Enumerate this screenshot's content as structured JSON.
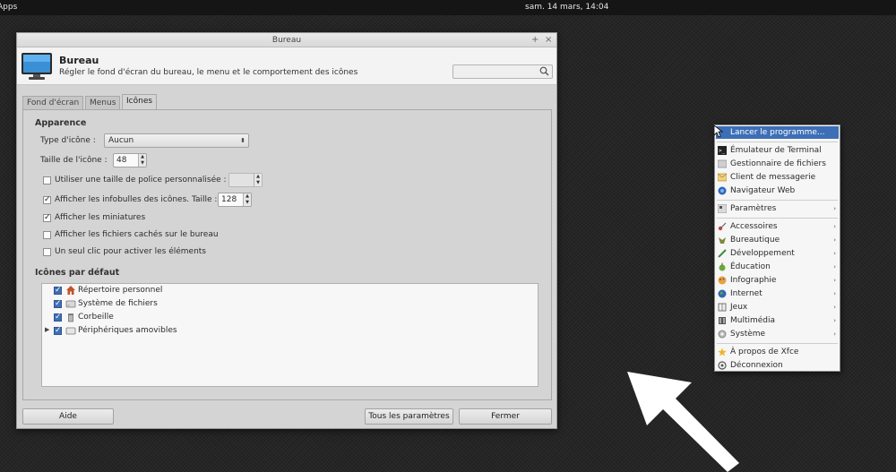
{
  "top_panel": {
    "apps_label": "Apps",
    "clock": "sam. 14 mars, 14:04"
  },
  "window": {
    "title": "Bureau",
    "controls": {
      "add": "+",
      "close": "×"
    },
    "header_title": "Bureau",
    "header_subtitle": "Régler le fond d'écran du bureau, le menu et le comportement des icônes",
    "search": {
      "value": "",
      "placeholder": ""
    },
    "tabs": [
      "Fond d'écran",
      "Menus",
      "Icônes"
    ],
    "active_tab": "Icônes",
    "appearance": {
      "section_title": "Apparence",
      "icon_type_label": "Type d'icône :",
      "icon_type_value": "Aucun",
      "icon_size_label": "Taille de l'icône :",
      "icon_size_value": "48",
      "custom_font_label": "Utiliser une taille de police personnalisée :",
      "custom_font_checked": false,
      "custom_font_value": "",
      "tooltips_label": "Afficher les infobulles des icônes. Taille :",
      "tooltips_checked": true,
      "tooltips_size_value": "128",
      "thumbnails_label": "Afficher les miniatures",
      "thumbnails_checked": true,
      "hidden_files_label": "Afficher les fichiers cachés sur le bureau",
      "hidden_files_checked": false,
      "single_click_label": "Un seul clic pour activer les éléments",
      "single_click_checked": false
    },
    "default_icons": {
      "section_title": "Icônes par défaut",
      "items": [
        {
          "label": "Répertoire personnel",
          "checked": true,
          "icon": "home-icon"
        },
        {
          "label": "Système de fichiers",
          "checked": true,
          "icon": "drive-icon"
        },
        {
          "label": "Corbeille",
          "checked": true,
          "icon": "trash-icon"
        },
        {
          "label": "Périphériques amovibles",
          "checked": true,
          "icon": "removable-drive-icon",
          "expandable": true
        }
      ]
    },
    "buttons": {
      "help": "Aide",
      "all_settings": "Tous les paramètres",
      "close": "Fermer"
    }
  },
  "menu": {
    "items": [
      {
        "label": "Lancer le programme...",
        "icon": "run-icon",
        "highlight": true
      },
      {
        "label": "Émulateur de Terminal",
        "icon": "terminal-icon"
      },
      {
        "label": "Gestionnaire de fichiers",
        "icon": "file-manager-icon"
      },
      {
        "label": "Client de messagerie",
        "icon": "mail-icon"
      },
      {
        "label": "Navigateur Web",
        "icon": "web-browser-icon"
      },
      {
        "label": "Paramètres",
        "icon": "settings-icon",
        "submenu": true
      },
      {
        "label": "Accessoires",
        "icon": "accessories-icon",
        "submenu": true
      },
      {
        "label": "Bureautique",
        "icon": "office-icon",
        "submenu": true
      },
      {
        "label": "Développement",
        "icon": "development-icon",
        "submenu": true
      },
      {
        "label": "Éducation",
        "icon": "education-icon",
        "submenu": true
      },
      {
        "label": "Infographie",
        "icon": "graphics-icon",
        "submenu": true
      },
      {
        "label": "Internet",
        "icon": "internet-icon",
        "submenu": true
      },
      {
        "label": "Jeux",
        "icon": "games-icon",
        "submenu": true
      },
      {
        "label": "Multimédia",
        "icon": "multimedia-icon",
        "submenu": true
      },
      {
        "label": "Système",
        "icon": "system-icon",
        "submenu": true
      },
      {
        "label": "À propos de Xfce",
        "icon": "star-icon"
      },
      {
        "label": "Déconnexion",
        "icon": "logout-icon"
      }
    ],
    "submenu_arrow": "›"
  },
  "colors": {
    "highlight": "#3d6fb7",
    "checkbox_blue": "#3f6fb5",
    "desktop": "#262626"
  }
}
